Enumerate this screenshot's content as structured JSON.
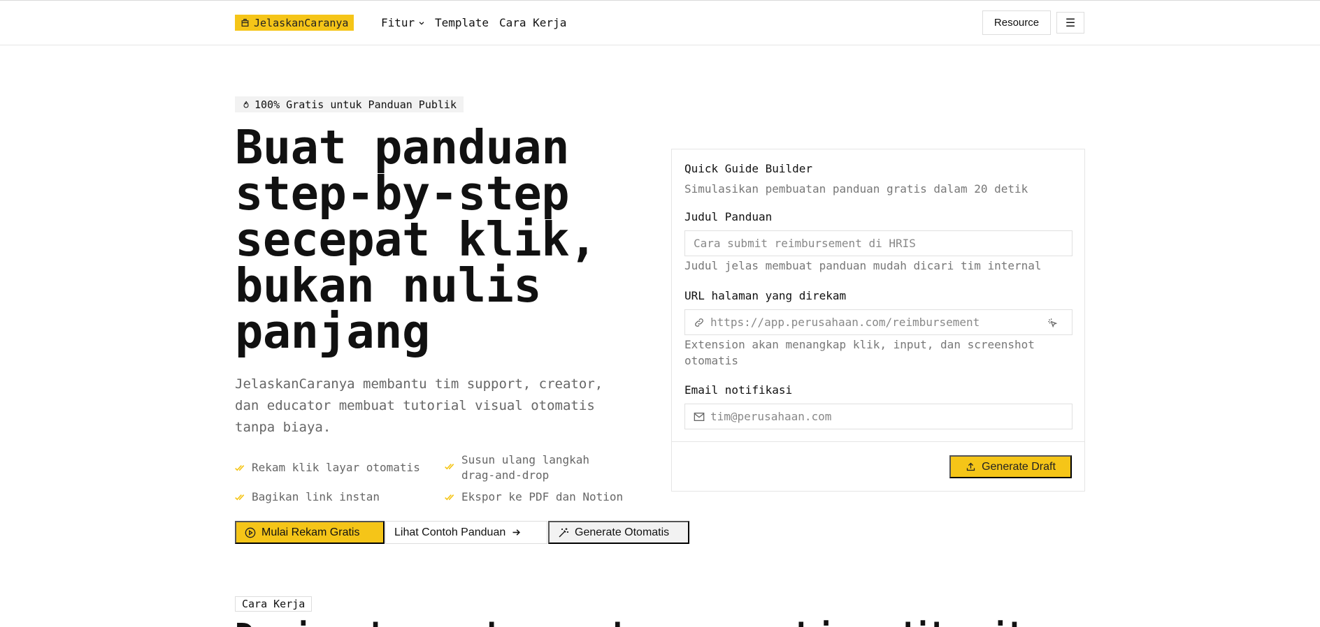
{
  "nav": {
    "logo": "JelaskanCaranya",
    "links": [
      {
        "label": "Fitur",
        "has_dropdown": true
      },
      {
        "label": "Template"
      },
      {
        "label": "Cara Kerja"
      }
    ],
    "resource_label": "Resource",
    "menu_icon": "☰"
  },
  "hero": {
    "badge": "100% Gratis untuk Panduan Publik",
    "headline": "Buat panduan step-by-step secepat klik, bukan nulis panjang",
    "subtitle": "JelaskanCaranya membantu tim support, creator, dan educator membuat tutorial visual otomatis tanpa biaya.",
    "features": [
      "Rekam klik layar otomatis",
      "Susun ulang langkah drag-and-drop",
      "Bagikan link instan",
      "Ekspor ke PDF dan Notion"
    ],
    "cta_primary": "Mulai Rekam Gratis",
    "cta_secondary": "Lihat Contoh Panduan",
    "cta_tertiary": "Generate Otomatis"
  },
  "builder": {
    "title": "Quick Guide Builder",
    "description": "Simulasikan pembuatan panduan gratis dalam 20 detik",
    "title_label": "Judul Panduan",
    "title_placeholder": "Cara submit reimbursement di HRIS",
    "title_hint": "Judul jelas membuat panduan mudah dicari tim internal",
    "url_label": "URL halaman yang direkam",
    "url_placeholder": "https://app.perusahaan.com/reimbursement",
    "url_hint": "Extension akan menangkap klik, input, dan screenshot otomatis",
    "email_label": "Email notifikasi",
    "email_placeholder": "tim@perusahaan.com",
    "submit_label": "Generate Draft"
  },
  "how_it_works": {
    "tag": "Cara Kerja",
    "title": "Dari rekaman ke panduan yang bisa dibagikan dalam hitungan menit"
  },
  "colors": {
    "accent": "#f5c518",
    "text": "#111111",
    "muted": "#666666",
    "border": "#e5e5e5"
  }
}
